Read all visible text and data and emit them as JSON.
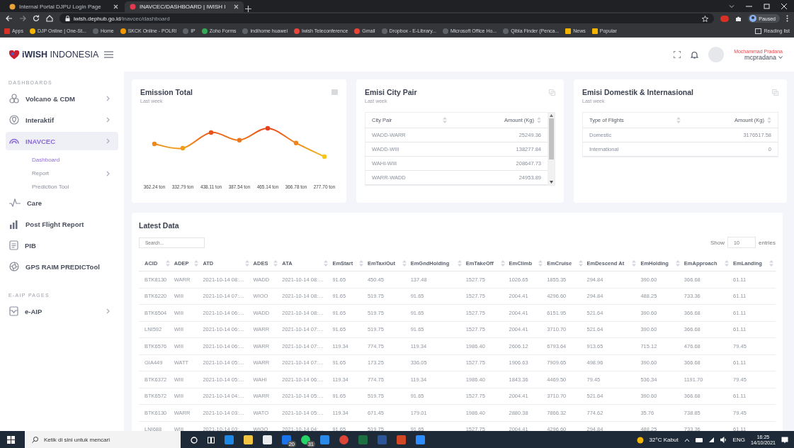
{
  "browser": {
    "tabs": [
      {
        "title": "Internal Portal DJPU Login Page",
        "selected": false
      },
      {
        "title": "INAVCEC/DASHBOARD | iWISH I",
        "selected": true
      }
    ],
    "url_host": "iwish.dephub.go.id",
    "url_path": "/inavcec/dashboard",
    "profile": "Paused",
    "bookmarks": [
      "Apps",
      "DJP Online | One-St...",
      "Home",
      "SKCK Online - POLRI",
      "IP",
      "Zoho Forms",
      "indihome huawei",
      "Iwish Teleconference",
      "Gmail",
      "Dropbox - E-Library...",
      "Microsoft Office Ho...",
      "Qibla Finder (Penca...",
      "News",
      "Popular"
    ],
    "reading_list": "Reading list"
  },
  "sidebar": {
    "logo": "**iWISH** INDONESIA",
    "sections": [
      {
        "heading": "DASHBOARDS",
        "items": [
          {
            "label": "Volcano & CDM",
            "submenu": true,
            "selected": false
          },
          {
            "label": "Interaktif",
            "submenu": true,
            "selected": false
          },
          {
            "label": "INAVCEC",
            "submenu": true,
            "selected": true,
            "children": [
              {
                "label": "Dashboard",
                "submenu": false,
                "selected": true
              },
              {
                "label": "Report",
                "submenu": true,
                "selected": false
              },
              {
                "label": "Prediction Tool",
                "submenu": false,
                "selected": false
              }
            ]
          },
          {
            "label": "Care",
            "submenu": false,
            "selected": false
          },
          {
            "label": "Post Flight Report",
            "submenu": false,
            "selected": false
          },
          {
            "label": "PIB",
            "submenu": false,
            "selected": false
          },
          {
            "label": "GPS RAIM PREDICTool",
            "submenu": false,
            "selected": false
          }
        ]
      },
      {
        "heading": "E-AIP PAGES",
        "items": [
          {
            "label": "e-AIP",
            "submenu": true,
            "selected": false
          }
        ]
      }
    ]
  },
  "header": {
    "user_name": "Mochammad Pradana",
    "username": "mcpradana"
  },
  "emission_total": {
    "title": "Emission Total",
    "subtitle": "Last week",
    "value_labels": [
      "362.24 ton",
      "332.79 ton",
      "438.11 ton",
      "387.54 ton",
      "465.14 ton",
      "366.78 ton",
      "277.70 ton"
    ]
  },
  "city_pair": {
    "title": "Emisi City Pair",
    "subtitle": "Last week",
    "columns": [
      "City Pair",
      "Amount (Kg)"
    ],
    "rows": [
      [
        "WADD-WARR",
        "25249.36"
      ],
      [
        "WADD-WIII",
        "138277.84"
      ],
      [
        "WAHI-WIII",
        "208647.73"
      ],
      [
        "WARR-WADD",
        "24953.89"
      ]
    ]
  },
  "domestic_international": {
    "title": "Emisi Domestik & Internasional",
    "subtitle": "Last week",
    "columns": [
      "Type of Flights",
      "Amount (Kg)"
    ],
    "rows": [
      [
        "Domestic",
        "3176517.58"
      ],
      [
        "International",
        "0"
      ]
    ]
  },
  "latest_data": {
    "title": "Latest Data",
    "search_placeholder": "Search...",
    "show_label": "Show",
    "page_size": "10",
    "entries_label": "entries",
    "columns": [
      "ACID",
      "ADEP",
      "ATD",
      "ADES",
      "ATA",
      "EmStart",
      "EmTaxiOut",
      "EmGndHolding",
      "EmTakeOff",
      "EmClimb",
      "EmCruise",
      "EmDescend At",
      "EmHolding",
      "EmApproach",
      "EmLanding"
    ],
    "rows": [
      [
        "BTK8130",
        "WARR",
        "2021-10-14 08:…",
        "WADD",
        "2021-10-14 08:…",
        "91.65",
        "450.45",
        "137.48",
        "1527.75",
        "1026.65",
        "1855.35",
        "294.84",
        "390.60",
        "366.68",
        "61.11"
      ],
      [
        "BTK6220",
        "WIII",
        "2021-10-14 07:…",
        "WIOO",
        "2021-10-14 08:…",
        "91.65",
        "519.75",
        "91.65",
        "1527.75",
        "2004.41",
        "4296.60",
        "294.84",
        "488.25",
        "733.36",
        "61.11"
      ],
      [
        "BTK6504",
        "WIII",
        "2021-10-14 06:…",
        "WADD",
        "2021-10-14 08:…",
        "91.65",
        "519.75",
        "91.65",
        "1527.75",
        "2004.41",
        "6151.95",
        "521.64",
        "390.60",
        "366.68",
        "61.11"
      ],
      [
        "LNI592",
        "WIII",
        "2021-10-14 06:…",
        "WARR",
        "2021-10-14 07:…",
        "91.65",
        "519.75",
        "91.65",
        "1527.75",
        "2004.41",
        "3710.70",
        "521.64",
        "390.60",
        "366.68",
        "61.11"
      ],
      [
        "BTK6576",
        "WIII",
        "2021-10-14 06:…",
        "WARR",
        "2021-10-14 07:…",
        "119.34",
        "774.75",
        "119.34",
        "1986.40",
        "2606.12",
        "6793.64",
        "913.65",
        "715.12",
        "476.68",
        "79.45"
      ],
      [
        "GIA449",
        "WATT",
        "2021-10-14 05:…",
        "WARR",
        "2021-10-14 07:…",
        "91.65",
        "173.25",
        "336.05",
        "1527.75",
        "1906.63",
        "7909.65",
        "498.96",
        "390.60",
        "366.68",
        "61.11"
      ],
      [
        "BTK6372",
        "WIII",
        "2021-10-14 05:…",
        "WAHI",
        "2021-10-14 06:…",
        "119.34",
        "774.75",
        "119.34",
        "1986.40",
        "1843.36",
        "4469.50",
        "79.45",
        "536.34",
        "1191.70",
        "79.45"
      ],
      [
        "BTK6572",
        "WIII",
        "2021-10-14 04:…",
        "WARR",
        "2021-10-14 05:…",
        "91.65",
        "519.75",
        "91.65",
        "1527.75",
        "2004.41",
        "3710.70",
        "521.64",
        "390.60",
        "366.68",
        "61.11"
      ],
      [
        "BTK6130",
        "WARR",
        "2021-10-14 03:…",
        "WATO",
        "2021-10-14 05:…",
        "119.34",
        "671.45",
        "179.01",
        "1986.40",
        "2880.38",
        "7866.32",
        "774.62",
        "35.76",
        "738.85",
        "79.45"
      ],
      [
        "LNI688",
        "WIII",
        "2021-10-14 03:…",
        "WIOO",
        "2021-10-14 04:…",
        "91.65",
        "519.75",
        "91.65",
        "1527.75",
        "2004.41",
        "4296.60",
        "294.84",
        "488.25",
        "733.36",
        "61.11"
      ]
    ]
  },
  "taskbar": {
    "search_placeholder": "Ketik di sini untuk mencari",
    "badges": [
      "20",
      "31"
    ],
    "weather": "32°C Kabut",
    "language": "ENG",
    "time": "16:25",
    "date": "14/10/2021"
  }
}
